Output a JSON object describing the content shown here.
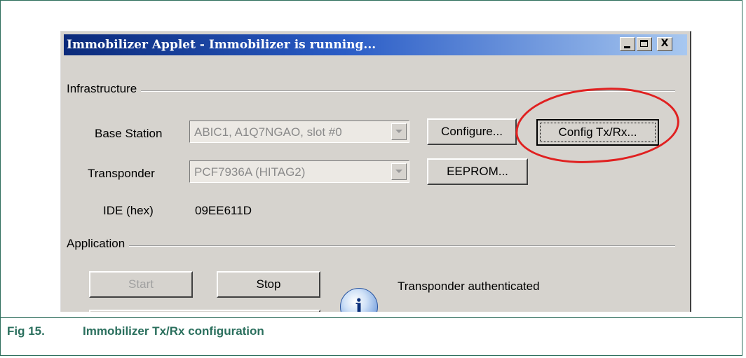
{
  "window": {
    "title": "Immobilizer Applet - Immobilizer is running...",
    "controls": {
      "minimize": "_",
      "maximize": "□",
      "close": "X"
    }
  },
  "infrastructure": {
    "group_label": "Infrastructure",
    "base_station_label": "Base Station",
    "base_station_value": "ABIC1, A1Q7NGAO, slot #0",
    "configure_button": "Configure...",
    "config_txrx_button": "Config Tx/Rx...",
    "transponder_label": "Transponder",
    "transponder_value": "PCF7936A (HITAG2)",
    "eeprom_button": "EEPROM...",
    "ide_label": "IDE (hex)",
    "ide_value": "09EE611D"
  },
  "application": {
    "group_label": "Application",
    "start_button": "Start",
    "stop_button": "Stop",
    "status_text": "Transponder authenticated",
    "status_icon": "info-icon"
  },
  "caption": {
    "number": "Fig 15.",
    "text": "Immobilizer Tx/Rx configuration"
  },
  "colors": {
    "caption": "#2a6f5d",
    "frame": "#2e6e5c",
    "highlight": "#e02020",
    "window_bg": "#d6d3ce",
    "title_bar": "#0b2a7a"
  }
}
